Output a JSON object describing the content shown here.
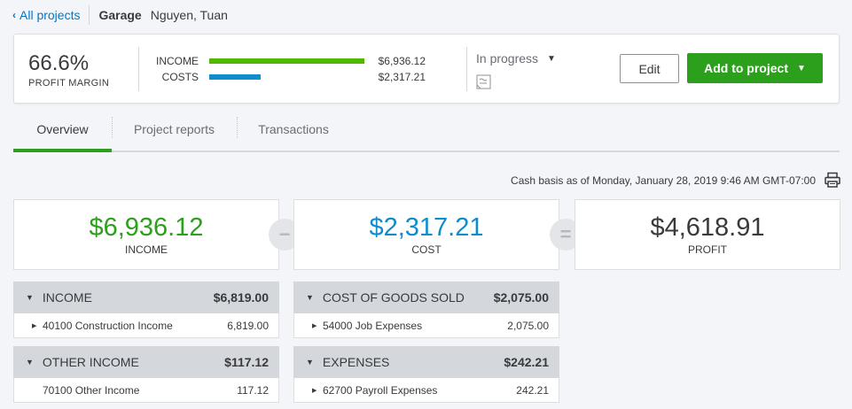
{
  "breadcrumb": {
    "back_label": "All projects",
    "project_name": "Garage",
    "customer_name": "Nguyen, Tuan"
  },
  "summary": {
    "profit_margin_value": "66.6%",
    "profit_margin_label": "PROFIT MARGIN",
    "income_label": "INCOME",
    "income_value": "$6,936.12",
    "income_fraction": 1.0,
    "costs_label": "COSTS",
    "costs_value": "$2,317.21",
    "costs_fraction": 0.334,
    "status": "In progress",
    "edit_label": "Edit",
    "add_label": "Add to project"
  },
  "tabs": [
    {
      "label": "Overview",
      "active": true
    },
    {
      "label": "Project reports",
      "active": false
    },
    {
      "label": "Transactions",
      "active": false
    }
  ],
  "basis_text": "Cash basis as of Monday, January 28, 2019 9:46 AM GMT-07:00",
  "cards": {
    "income": {
      "amount": "$6,936.12",
      "label": "INCOME"
    },
    "cost": {
      "amount": "$2,317.21",
      "label": "COST"
    },
    "profit": {
      "amount": "$4,618.91",
      "label": "PROFIT"
    },
    "minus_symbol": "−",
    "equals_symbol": "="
  },
  "panels": {
    "income": {
      "title": "INCOME",
      "total": "$6,819.00",
      "rows": [
        {
          "account": "40100 Construction Income",
          "value": "6,819.00"
        }
      ]
    },
    "cogs": {
      "title": "COST OF GOODS SOLD",
      "total": "$2,075.00",
      "rows": [
        {
          "account": "54000 Job Expenses",
          "value": "2,075.00"
        }
      ]
    },
    "other_income": {
      "title": "OTHER INCOME",
      "total": "$117.12",
      "rows": [
        {
          "account": "70100 Other Income",
          "value": "117.12"
        }
      ]
    },
    "expenses": {
      "title": "EXPENSES",
      "total": "$242.21",
      "rows": [
        {
          "account": "62700 Payroll Expenses",
          "value": "242.21"
        }
      ]
    }
  },
  "colors": {
    "income": "#53b700",
    "cost": "#0d8ccf",
    "green": "#2ca01c",
    "link": "#0077c5"
  },
  "icons": {
    "back": "chevron-left-icon",
    "status": "caret-down-icon",
    "note": "note-icon",
    "print": "printer-icon"
  }
}
